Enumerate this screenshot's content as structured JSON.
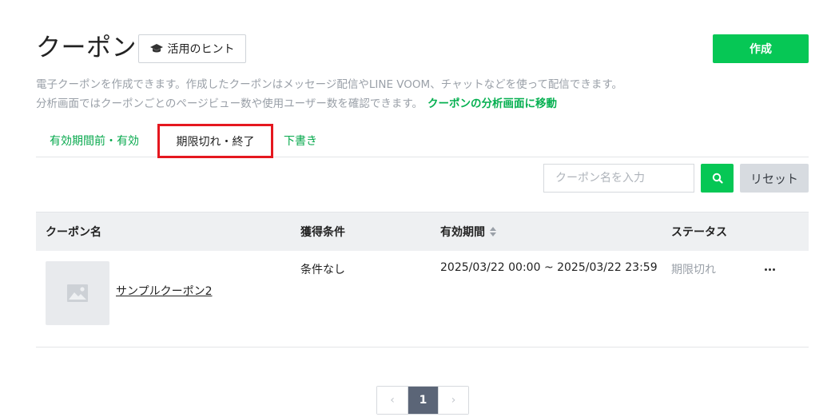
{
  "page": {
    "title": "クーポン",
    "hint_label": "活用のヒント",
    "create_label": "作成"
  },
  "description": {
    "line1": "電子クーポンを作成できます。作成したクーポンはメッセージ配信やLINE VOOM、チャットなどを使って配信できます。",
    "line2": "分析画面ではクーポンごとのページビュー数や使用ユーザー数を確認できます。",
    "link": "クーポンの分析画面に移動"
  },
  "tabs": [
    {
      "label": "有効期間前・有効"
    },
    {
      "label": "期限切れ・終了"
    },
    {
      "label": "下書き"
    }
  ],
  "search": {
    "placeholder": "クーポン名を入力",
    "reset_label": "リセット"
  },
  "table": {
    "columns": {
      "name": "クーポン名",
      "condition": "獲得条件",
      "period": "有効期間",
      "status": "ステータス"
    },
    "rows": [
      {
        "name": "サンプルクーポン2",
        "condition": "条件なし",
        "period": "2025/03/22 00:00 ~ 2025/03/22 23:59",
        "status": "期限切れ"
      }
    ]
  },
  "pagination": {
    "current": "1",
    "prev": "‹",
    "next": "›"
  },
  "colors": {
    "brand_green": "#06c755",
    "highlight_red": "#e5171f",
    "pagination_active": "#5b6577"
  },
  "icons": {
    "hint": "graduation-cap-icon",
    "search": "search-icon",
    "image_placeholder": "image-icon",
    "more": "more-horizontal-icon",
    "sort": "sort-icon"
  }
}
